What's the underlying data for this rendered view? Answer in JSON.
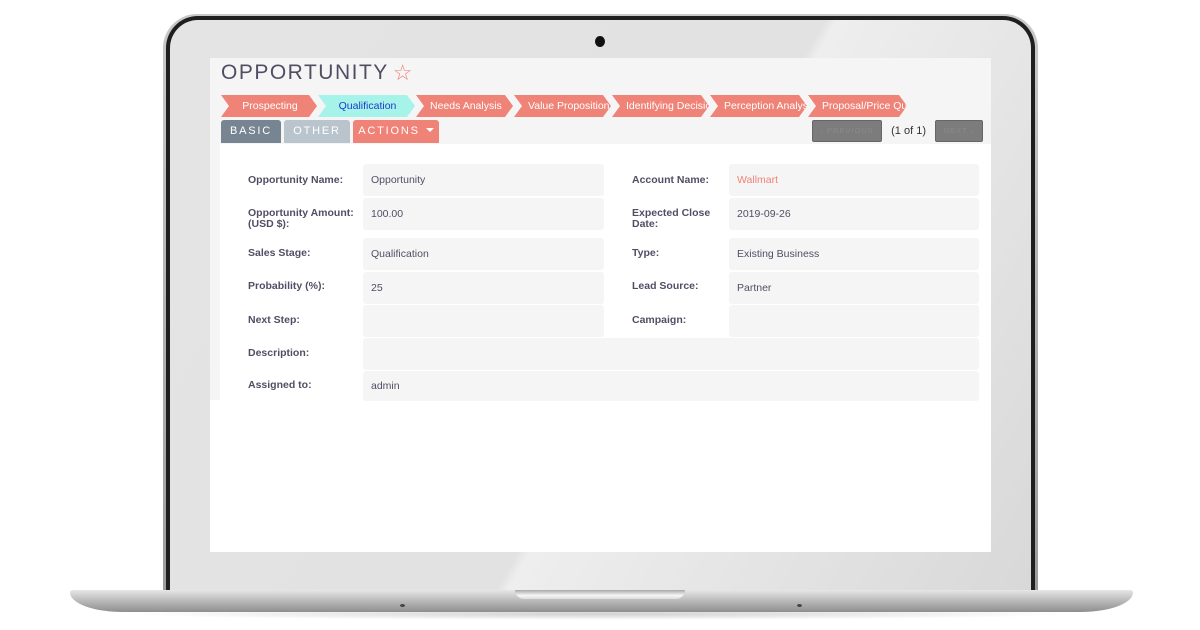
{
  "page": {
    "title": "OPPORTUNITY",
    "favorite_icon": "star-outline-icon"
  },
  "stages": [
    {
      "label": "Prospecting",
      "active": false
    },
    {
      "label": "Qualification",
      "active": true
    },
    {
      "label": "Needs Analysis",
      "active": false
    },
    {
      "label": "Value Proposition",
      "active": false
    },
    {
      "label": "Identifying Decisio",
      "active": false
    },
    {
      "label": "Perception Analysi",
      "active": false
    },
    {
      "label": "Proposal/Price Quc",
      "active": false
    }
  ],
  "tabs": {
    "basic": "BASIC",
    "other": "OTHER",
    "actions": "ACTIONS"
  },
  "pager": {
    "previous": "‹  PREVIOUS",
    "info": "(1 of 1)",
    "next": "NEXT ›"
  },
  "fields": {
    "opportunity_name": {
      "label": "Opportunity Name:",
      "value": "Opportunity"
    },
    "opportunity_amount": {
      "label": "Opportunity Amount: (USD $):",
      "value": "100.00"
    },
    "sales_stage": {
      "label": "Sales Stage:",
      "value": "Qualification"
    },
    "probability": {
      "label": "Probability (%):",
      "value": "25"
    },
    "next_step": {
      "label": "Next Step:",
      "value": ""
    },
    "description": {
      "label": "Description:",
      "value": ""
    },
    "assigned_to": {
      "label": "Assigned to:",
      "value": "admin"
    },
    "account_name": {
      "label": "Account Name:",
      "value": "Wallmart"
    },
    "expected_close_date": {
      "label": "Expected Close Date:",
      "value": "2019-09-26"
    },
    "type": {
      "label": "Type:",
      "value": "Existing Business"
    },
    "lead_source": {
      "label": "Lead Source:",
      "value": "Partner"
    },
    "campaign": {
      "label": "Campaign:",
      "value": ""
    }
  },
  "colors": {
    "accent": "#f08377",
    "active_stage": "#a5f3e9",
    "text": "#534d64"
  }
}
